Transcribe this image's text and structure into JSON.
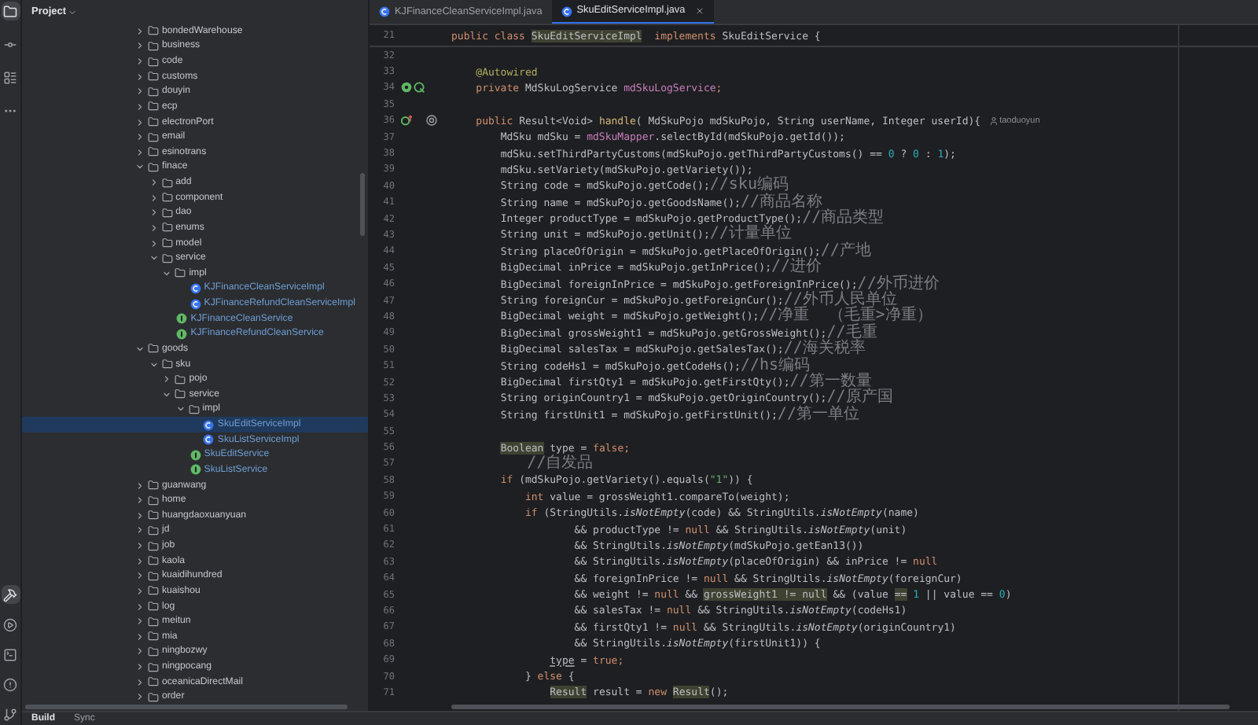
{
  "sidebar_tools": [
    {
      "kind": "folder",
      "selected": true
    },
    {
      "kind": "commit",
      "selected": false
    },
    {
      "kind": "structure",
      "selected": false
    },
    {
      "kind": "more",
      "selected": false
    }
  ],
  "bottom_tools": [
    {
      "kind": "build",
      "selected": true
    },
    {
      "kind": "run",
      "selected": false
    },
    {
      "kind": "terminal",
      "selected": false
    },
    {
      "kind": "problems",
      "selected": false
    },
    {
      "kind": "git",
      "selected": false
    }
  ],
  "project_panel": {
    "title": "Project",
    "tree": [
      {
        "name": "bondedWarehouse",
        "kind": "folder",
        "expanded": false,
        "selected": false
      },
      {
        "name": "business",
        "kind": "folder",
        "expanded": false,
        "selected": false
      },
      {
        "name": "code",
        "kind": "folder",
        "expanded": false,
        "selected": false
      },
      {
        "name": "customs",
        "kind": "folder",
        "expanded": false,
        "selected": false
      },
      {
        "name": "douyin",
        "kind": "folder",
        "expanded": false,
        "selected": false
      },
      {
        "name": "ecp",
        "kind": "folder",
        "expanded": false,
        "selected": false
      },
      {
        "name": "electronPort",
        "kind": "folder",
        "expanded": false,
        "selected": false
      },
      {
        "name": "email",
        "kind": "folder",
        "expanded": false,
        "selected": false
      },
      {
        "name": "esinotrans",
        "kind": "folder",
        "expanded": false,
        "selected": false
      },
      {
        "name": "finace",
        "kind": "folder",
        "expanded": true,
        "selected": false,
        "children": [
          {
            "name": "add",
            "kind": "folder",
            "expanded": false,
            "selected": false
          },
          {
            "name": "component",
            "kind": "folder",
            "expanded": false,
            "selected": false
          },
          {
            "name": "dao",
            "kind": "folder",
            "expanded": false,
            "selected": false
          },
          {
            "name": "enums",
            "kind": "folder",
            "expanded": false,
            "selected": false
          },
          {
            "name": "model",
            "kind": "folder",
            "expanded": false,
            "selected": false
          },
          {
            "name": "service",
            "kind": "folder",
            "expanded": true,
            "selected": false,
            "children": [
              {
                "name": "impl",
                "kind": "folder",
                "expanded": true,
                "selected": false,
                "children": [
                  {
                    "name": "KJFinanceCleanServiceImpl",
                    "kind": "class",
                    "selected": false
                  },
                  {
                    "name": "KJFinanceRefundCleanServiceImpl",
                    "kind": "class",
                    "selected": false
                  }
                ]
              },
              {
                "name": "KJFinanceCleanService",
                "kind": "interface",
                "selected": false
              },
              {
                "name": "KJFinanceRefundCleanService",
                "kind": "interface",
                "selected": false
              }
            ]
          }
        ]
      },
      {
        "name": "goods",
        "kind": "folder",
        "expanded": true,
        "selected": false,
        "children": [
          {
            "name": "sku",
            "kind": "folder",
            "expanded": true,
            "selected": false,
            "children": [
              {
                "name": "pojo",
                "kind": "folder",
                "expanded": false,
                "selected": false
              },
              {
                "name": "service",
                "kind": "folder",
                "expanded": true,
                "selected": false,
                "children": [
                  {
                    "name": "impl",
                    "kind": "folder",
                    "expanded": true,
                    "selected": false,
                    "children": [
                      {
                        "name": "SkuEditServiceImpl",
                        "kind": "class",
                        "selected": true
                      },
                      {
                        "name": "SkuListServiceImpl",
                        "kind": "class",
                        "selected": false
                      }
                    ]
                  },
                  {
                    "name": "SkuEditService",
                    "kind": "interface",
                    "selected": false
                  },
                  {
                    "name": "SkuListService",
                    "kind": "interface",
                    "selected": false
                  }
                ]
              }
            ]
          }
        ]
      },
      {
        "name": "guanwang",
        "kind": "folder",
        "expanded": false,
        "selected": false
      },
      {
        "name": "home",
        "kind": "folder",
        "expanded": false,
        "selected": false
      },
      {
        "name": "huangdaoxuanyuan",
        "kind": "folder",
        "expanded": false,
        "selected": false
      },
      {
        "name": "jd",
        "kind": "folder",
        "expanded": false,
        "selected": false
      },
      {
        "name": "job",
        "kind": "folder",
        "expanded": false,
        "selected": false
      },
      {
        "name": "kaola",
        "kind": "folder",
        "expanded": false,
        "selected": false
      },
      {
        "name": "kuaidihundred",
        "kind": "folder",
        "expanded": false,
        "selected": false
      },
      {
        "name": "kuaishou",
        "kind": "folder",
        "expanded": false,
        "selected": false
      },
      {
        "name": "log",
        "kind": "folder",
        "expanded": false,
        "selected": false
      },
      {
        "name": "meitun",
        "kind": "folder",
        "expanded": false,
        "selected": false
      },
      {
        "name": "mia",
        "kind": "folder",
        "expanded": false,
        "selected": false
      },
      {
        "name": "ningbozwy",
        "kind": "folder",
        "expanded": false,
        "selected": false
      },
      {
        "name": "ningpocang",
        "kind": "folder",
        "expanded": false,
        "selected": false
      },
      {
        "name": "oceanicaDirectMail",
        "kind": "folder",
        "expanded": false,
        "selected": false
      },
      {
        "name": "order",
        "kind": "folder",
        "expanded": false,
        "selected": false
      }
    ]
  },
  "tabs": [
    {
      "label": "KJFinanceCleanServiceImpl.java",
      "selected": false
    },
    {
      "label": "SkuEditServiceImpl.java",
      "selected": true
    }
  ],
  "sticky_line": {
    "number": "21",
    "tokens": [
      {
        "text": "public class ",
        "kind": "kw"
      },
      {
        "text": "SkuEditServiceImpl",
        "kind": "hl"
      },
      {
        "text": "  implements ",
        "kind": "kw"
      },
      {
        "text": "SkuEditService {",
        "kind": "plain"
      }
    ]
  },
  "code_lines": [
    {
      "number": "32",
      "kind": "plain"
    },
    {
      "number": "33",
      "tokens": [
        {
          "text": "    @Autowired",
          "kind": "ann"
        }
      ]
    },
    {
      "number": "34",
      "kind": "bean",
      "tokens": [
        {
          "text": "    private ",
          "kind": "kw"
        },
        {
          "text": "MdSkuLogService ",
          "kind": "plain"
        },
        {
          "text": "mdSkuLogService",
          "kind": "field"
        },
        {
          "text": ";",
          "kind": "kw"
        }
      ]
    },
    {
      "number": "35",
      "kind": "plain"
    },
    {
      "number": "36",
      "kind": "override",
      "author": "taoduoyun",
      "tokens": [
        {
          "text": "    public ",
          "kind": "kw"
        },
        {
          "text": "Result<Void> ",
          "kind": "plain"
        },
        {
          "text": "handle",
          "kind": "method"
        },
        {
          "text": "( MdSkuPojo mdSkuPojo, String userName, Integer userId){",
          "kind": "plain"
        }
      ]
    },
    {
      "number": "37",
      "tokens": [
        {
          "text": "        MdSku mdSku = ",
          "kind": "plain"
        },
        {
          "text": "mdSkuMapper",
          "kind": "field"
        },
        {
          "text": ".selectById(mdSkuPojo.getId());",
          "kind": "plain"
        }
      ]
    },
    {
      "number": "38",
      "tokens": [
        {
          "text": "        mdSku.setThirdPartyCustoms(mdSkuPojo.getThirdPartyCustoms() == ",
          "kind": "plain"
        },
        {
          "text": "0",
          "kind": "num"
        },
        {
          "text": " ? ",
          "kind": "plain"
        },
        {
          "text": "0",
          "kind": "num"
        },
        {
          "text": " : ",
          "kind": "plain"
        },
        {
          "text": "1",
          "kind": "num"
        },
        {
          "text": ");",
          "kind": "plain"
        }
      ]
    },
    {
      "number": "39",
      "tokens": [
        {
          "text": "        mdSku.setVariety(mdSkuPojo.getVariety());",
          "kind": "plain"
        }
      ]
    },
    {
      "number": "40",
      "tokens": [
        {
          "text": "        String code = mdSkuPojo.getCode();",
          "kind": "plain"
        },
        {
          "text": "//sku编码",
          "kind": "comment"
        }
      ]
    },
    {
      "number": "41",
      "tokens": [
        {
          "text": "        String name = mdSkuPojo.getGoodsName();",
          "kind": "plain"
        },
        {
          "text": "//商品名称",
          "kind": "comment"
        }
      ]
    },
    {
      "number": "42",
      "tokens": [
        {
          "text": "        Integer productType = mdSkuPojo.getProductType();",
          "kind": "plain"
        },
        {
          "text": "//商品类型",
          "kind": "comment"
        }
      ]
    },
    {
      "number": "43",
      "tokens": [
        {
          "text": "        String unit = mdSkuPojo.getUnit();",
          "kind": "plain"
        },
        {
          "text": "//计量单位",
          "kind": "comment"
        }
      ]
    },
    {
      "number": "44",
      "tokens": [
        {
          "text": "        String placeOfOrigin = mdSkuPojo.getPlaceOfOrigin();",
          "kind": "plain"
        },
        {
          "text": "//产地",
          "kind": "comment"
        }
      ]
    },
    {
      "number": "45",
      "tokens": [
        {
          "text": "        BigDecimal inPrice = mdSkuPojo.getInPrice();",
          "kind": "plain"
        },
        {
          "text": "//进价",
          "kind": "comment"
        }
      ]
    },
    {
      "number": "46",
      "tokens": [
        {
          "text": "        BigDecimal foreignInPrice = mdSkuPojo.getForeignInPrice();",
          "kind": "plain"
        },
        {
          "text": "//外币进价",
          "kind": "comment"
        }
      ]
    },
    {
      "number": "47",
      "tokens": [
        {
          "text": "        String foreignCur = mdSkuPojo.getForeignCur();",
          "kind": "plain"
        },
        {
          "text": "//外币人民单位",
          "kind": "comment"
        }
      ]
    },
    {
      "number": "48",
      "tokens": [
        {
          "text": "        BigDecimal weight = mdSkuPojo.getWeight();",
          "kind": "plain"
        },
        {
          "text": "//净重  （毛重>净重）",
          "kind": "comment"
        }
      ]
    },
    {
      "number": "49",
      "tokens": [
        {
          "text": "        BigDecimal grossWeight1 = mdSkuPojo.getGrossWeight();",
          "kind": "plain"
        },
        {
          "text": "//毛重",
          "kind": "comment"
        }
      ]
    },
    {
      "number": "50",
      "tokens": [
        {
          "text": "        BigDecimal salesTax = mdSkuPojo.getSalesTax();",
          "kind": "plain"
        },
        {
          "text": "//海关税率",
          "kind": "comment"
        }
      ]
    },
    {
      "number": "51",
      "tokens": [
        {
          "text": "        String codeHs1 = mdSkuPojo.getCodeHs();",
          "kind": "plain"
        },
        {
          "text": "//hs编码",
          "kind": "comment"
        }
      ]
    },
    {
      "number": "52",
      "tokens": [
        {
          "text": "        BigDecimal firstQty1 = mdSkuPojo.getFirstQty();",
          "kind": "plain"
        },
        {
          "text": "//第一数量",
          "kind": "comment"
        }
      ]
    },
    {
      "number": "53",
      "tokens": [
        {
          "text": "        String originCountry1 = mdSkuPojo.getOriginCountry();",
          "kind": "plain"
        },
        {
          "text": "//原产国",
          "kind": "comment"
        }
      ]
    },
    {
      "number": "54",
      "tokens": [
        {
          "text": "        String firstUnit1 = mdSkuPojo.getFirstUnit();",
          "kind": "plain"
        },
        {
          "text": "//第一单位",
          "kind": "comment"
        }
      ]
    },
    {
      "number": "55",
      "kind": "plain"
    },
    {
      "number": "56",
      "tokens": [
        {
          "text": "        Boolean",
          "kind": "hl"
        },
        {
          "text": " type = ",
          "kind": "plain"
        },
        {
          "text": "false",
          "kind": "kw"
        },
        {
          "text": ";",
          "kind": "kw"
        }
      ]
    },
    {
      "number": "57",
      "tokens": [
        {
          "text": "        //自发品",
          "kind": "comment"
        }
      ]
    },
    {
      "number": "58",
      "tokens": [
        {
          "text": "        if ",
          "kind": "kw"
        },
        {
          "text": "(mdSkuPojo.getVariety().equals(",
          "kind": "plain"
        },
        {
          "text": "\"1\"",
          "kind": "str"
        },
        {
          "text": ")) {",
          "kind": "plain"
        }
      ]
    },
    {
      "number": "59",
      "tokens": [
        {
          "text": "            int ",
          "kind": "kw"
        },
        {
          "text": "value = grossWeight1.compareTo(weight);",
          "kind": "plain"
        }
      ]
    },
    {
      "number": "60",
      "tokens": [
        {
          "text": "            if ",
          "kind": "kw"
        },
        {
          "text": "(StringUtils.",
          "kind": "plain"
        },
        {
          "text": "isNotEmpty",
          "kind": "static"
        },
        {
          "text": "(code) && StringUtils.",
          "kind": "plain"
        },
        {
          "text": "isNotEmpty",
          "kind": "static"
        },
        {
          "text": "(name)",
          "kind": "plain"
        }
      ]
    },
    {
      "number": "61",
      "tokens": [
        {
          "text": "                    && productType != ",
          "kind": "plain"
        },
        {
          "text": "null",
          "kind": "kw"
        },
        {
          "text": " && StringUtils.",
          "kind": "plain"
        },
        {
          "text": "isNotEmpty",
          "kind": "static"
        },
        {
          "text": "(unit)",
          "kind": "plain"
        }
      ]
    },
    {
      "number": "62",
      "tokens": [
        {
          "text": "                    && StringUtils.",
          "kind": "plain"
        },
        {
          "text": "isNotEmpty",
          "kind": "static"
        },
        {
          "text": "(mdSkuPojo.getEan13())",
          "kind": "plain"
        }
      ]
    },
    {
      "number": "63",
      "tokens": [
        {
          "text": "                    && StringUtils.",
          "kind": "plain"
        },
        {
          "text": "isNotEmpty",
          "kind": "static"
        },
        {
          "text": "(placeOfOrigin) && inPrice != ",
          "kind": "plain"
        },
        {
          "text": "null",
          "kind": "kw"
        }
      ]
    },
    {
      "number": "64",
      "tokens": [
        {
          "text": "                    && foreignInPrice != ",
          "kind": "plain"
        },
        {
          "text": "null",
          "kind": "kw"
        },
        {
          "text": " && StringUtils.",
          "kind": "plain"
        },
        {
          "text": "isNotEmpty",
          "kind": "static"
        },
        {
          "text": "(foreignCur)",
          "kind": "plain"
        }
      ]
    },
    {
      "number": "65",
      "tokens": [
        {
          "text": "                    && weight != ",
          "kind": "plain"
        },
        {
          "text": "null",
          "kind": "kw"
        },
        {
          "text": " && ",
          "kind": "plain"
        },
        {
          "text": "grossWeight1 != null",
          "kind": "hl"
        },
        {
          "text": " && (value ",
          "kind": "plain"
        },
        {
          "text": "==",
          "kind": "hl"
        },
        {
          "text": " 1",
          "kind": "num"
        },
        {
          "text": " || value == ",
          "kind": "plain"
        },
        {
          "text": "0",
          "kind": "num"
        },
        {
          "text": ")",
          "kind": "plain"
        }
      ]
    },
    {
      "number": "66",
      "tokens": [
        {
          "text": "                    && salesTax != ",
          "kind": "plain"
        },
        {
          "text": "null",
          "kind": "kw"
        },
        {
          "text": " && StringUtils.",
          "kind": "plain"
        },
        {
          "text": "isNotEmpty",
          "kind": "static"
        },
        {
          "text": "(codeHs1)",
          "kind": "plain"
        }
      ]
    },
    {
      "number": "67",
      "tokens": [
        {
          "text": "                    && firstQty1 != ",
          "kind": "plain"
        },
        {
          "text": "null",
          "kind": "kw"
        },
        {
          "text": " && StringUtils.",
          "kind": "plain"
        },
        {
          "text": "isNotEmpty",
          "kind": "static"
        },
        {
          "text": "(originCountry1)",
          "kind": "plain"
        }
      ]
    },
    {
      "number": "68",
      "tokens": [
        {
          "text": "                    && StringUtils.",
          "kind": "plain"
        },
        {
          "text": "isNotEmpty",
          "kind": "static"
        },
        {
          "text": "(firstUnit1)) {",
          "kind": "plain"
        }
      ]
    },
    {
      "number": "69",
      "tokens": [
        {
          "text": "                type",
          "kind": "ul"
        },
        {
          "text": " = ",
          "kind": "plain"
        },
        {
          "text": "true",
          "kind": "kw"
        },
        {
          "text": ";",
          "kind": "kw"
        }
      ]
    },
    {
      "number": "70",
      "tokens": [
        {
          "text": "            } ",
          "kind": "plain"
        },
        {
          "text": "else ",
          "kind": "kw"
        },
        {
          "text": "{",
          "kind": "plain"
        }
      ]
    },
    {
      "number": "71",
      "tokens": [
        {
          "text": "                Result",
          "kind": "hl"
        },
        {
          "text": " result = ",
          "kind": "plain"
        },
        {
          "text": "new ",
          "kind": "kw"
        },
        {
          "text": "Result",
          "kind": "hl"
        },
        {
          "text": "();",
          "kind": "plain"
        }
      ]
    }
  ],
  "bottom_bar": {
    "tabs": [
      {
        "label": "Build",
        "selected": true
      },
      {
        "label": "Sync",
        "selected": false
      }
    ]
  }
}
